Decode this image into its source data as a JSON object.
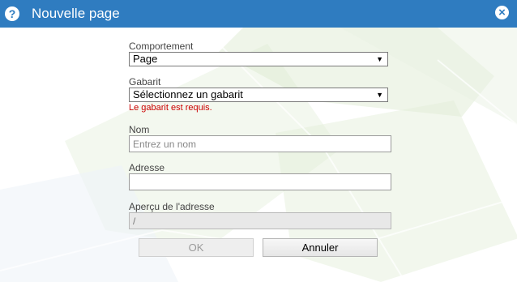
{
  "window": {
    "title": "Nouvelle page",
    "help_icon": "?",
    "close_icon": "×"
  },
  "form": {
    "comportement": {
      "label": "Comportement",
      "value": "Page"
    },
    "gabarit": {
      "label": "Gabarit",
      "value": "Sélectionnez un gabarit",
      "error": "Le gabarit est requis."
    },
    "nom": {
      "label": "Nom",
      "placeholder": "Entrez un nom",
      "value": ""
    },
    "adresse": {
      "label": "Adresse",
      "value": ""
    },
    "apercu": {
      "label": "Aperçu de l'adresse",
      "value": "/"
    }
  },
  "buttons": {
    "ok": "OK",
    "annuler": "Annuler"
  },
  "colors": {
    "titlebar": "#2f7cc0",
    "error": "#cc0000"
  }
}
